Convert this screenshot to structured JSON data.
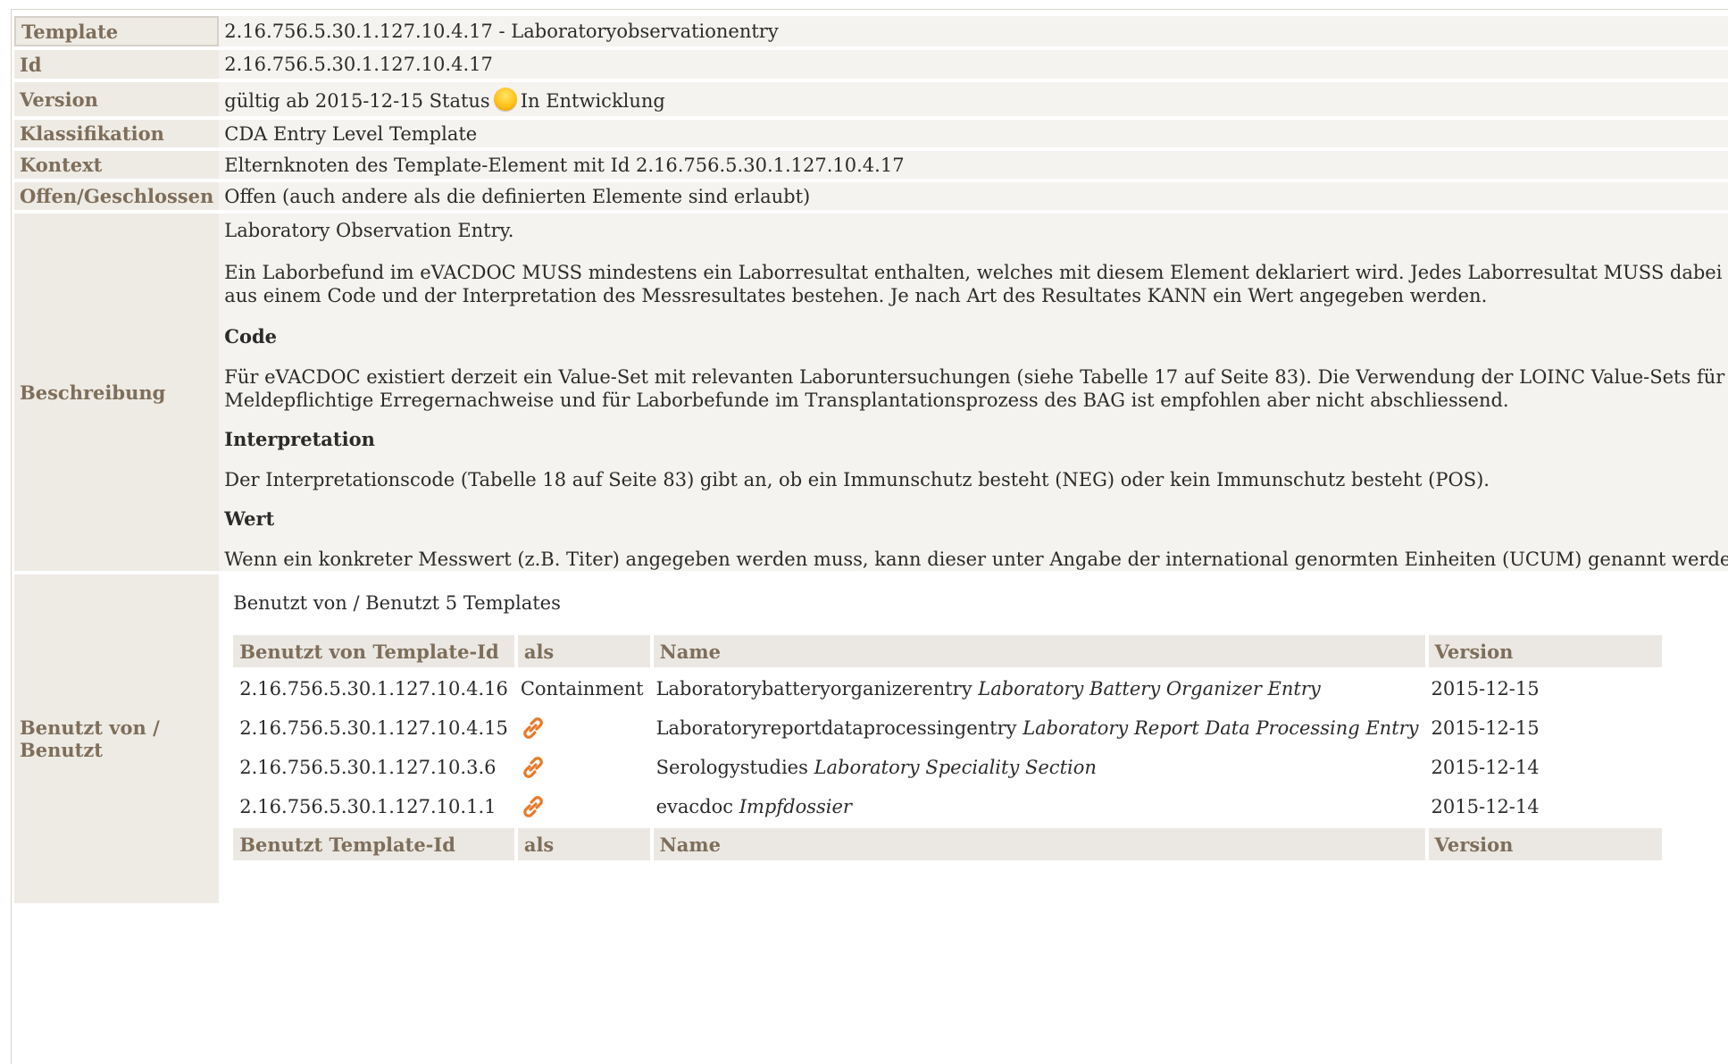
{
  "rows": {
    "template": {
      "label": "Template",
      "value": "2.16.756.5.30.1.127.10.4.17 - Laboratoryobservationentry"
    },
    "id": {
      "label": "Id",
      "value": "2.16.756.5.30.1.127.10.4.17"
    },
    "version": {
      "label": "Version",
      "prefix": "gültig ab 2015-12-15 Status",
      "status": "In Entwicklung",
      "status_color": "#ffc21a"
    },
    "klassifikation": {
      "label": "Klassifikation",
      "value": "CDA Entry Level Template"
    },
    "kontext": {
      "label": "Kontext",
      "value": "Elternknoten des Template-Element mit Id 2.16.756.5.30.1.127.10.4.17"
    },
    "offen": {
      "label": "Offen/Geschlossen",
      "value": "Offen (auch andere als die definierten Elemente sind erlaubt)"
    },
    "beschreibung": {
      "label": "Beschreibung",
      "intro": "Laboratory Observation Entry.",
      "p1": "Ein Laborbefund im eVACDOC MUSS mindestens ein Laborresultat enthalten, welches mit diesem Element deklariert wird. Jedes Laborresultat MUSS dabei aus einem Code und der Interpretation des Messresultates bestehen. Je nach Art des Resultates KANN ein Wert angegeben werden.",
      "h_code": "Code",
      "p_code": "Für eVACDOC existiert derzeit ein Value-Set mit relevanten Laboruntersuchungen (siehe Tabelle 17 auf Seite 83). Die Verwendung der LOINC Value-Sets für Meldepflichtige Erregernachweise und für Laborbefunde im Transplantationsprozess des BAG ist empfohlen aber nicht abschliessend.",
      "h_interp": "Interpretation",
      "p_interp": "Der Interpretationscode (Tabelle 18 auf Seite 83) gibt an, ob ein Immunschutz besteht (NEG) oder kein Immunschutz besteht (POS).",
      "h_wert": "Wert",
      "p_wert": "Wenn ein konkreter Messwert (z.B. Titer) angegeben werden muss, kann dieser unter Angabe der international genormten Einheiten (UCUM) genannt werden."
    },
    "benutzt": {
      "label": "Benutzt von / Benutzt",
      "title": "Benutzt von / Benutzt 5 Templates",
      "headers_used_by": [
        "Benutzt von Template-Id",
        "als",
        "Name",
        "Version"
      ],
      "used_by": [
        {
          "id": "2.16.756.5.30.1.127.10.4.16",
          "als": "Containment",
          "name": "Laboratorybatteryorganizerentry",
          "name_it": "Laboratory Battery Organizer Entry",
          "version": "2015-12-15"
        },
        {
          "id": "2.16.756.5.30.1.127.10.4.15",
          "als": "link-icon",
          "name": "Laboratoryreportdataprocessingentry",
          "name_it": "Laboratory Report Data Processing Entry",
          "version": "2015-12-15"
        },
        {
          "id": "2.16.756.5.30.1.127.10.3.6",
          "als": "link-icon",
          "name": "Serologystudies",
          "name_it": "Laboratory Speciality Section",
          "version": "2015-12-14"
        },
        {
          "id": "2.16.756.5.30.1.127.10.1.1",
          "als": "link-icon",
          "name": "evacdoc",
          "name_it": "Impfdossier",
          "version": "2015-12-14"
        }
      ],
      "headers_uses": [
        "Benutzt Template-Id",
        "als",
        "Name",
        "Version"
      ]
    }
  }
}
